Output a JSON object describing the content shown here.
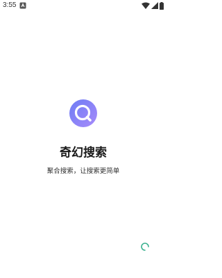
{
  "status_bar": {
    "time": "3:55",
    "notification_icon": "android-notification-icon",
    "wifi_icon": "wifi-icon",
    "signal_icon": "cell-signal-icon",
    "battery_icon": "battery-icon"
  },
  "splash": {
    "logo_icon": "magnifier-logo-icon",
    "title": "奇幻搜索",
    "tagline": "聚合搜索，让搜索更简单"
  },
  "loader": {
    "icon": "loading-spinner-icon",
    "accent_color": "#3bb18f"
  },
  "colors": {
    "logo_gradient_start": "#6d7cf4",
    "logo_gradient_end": "#a78bfa",
    "background": "#ffffff"
  }
}
